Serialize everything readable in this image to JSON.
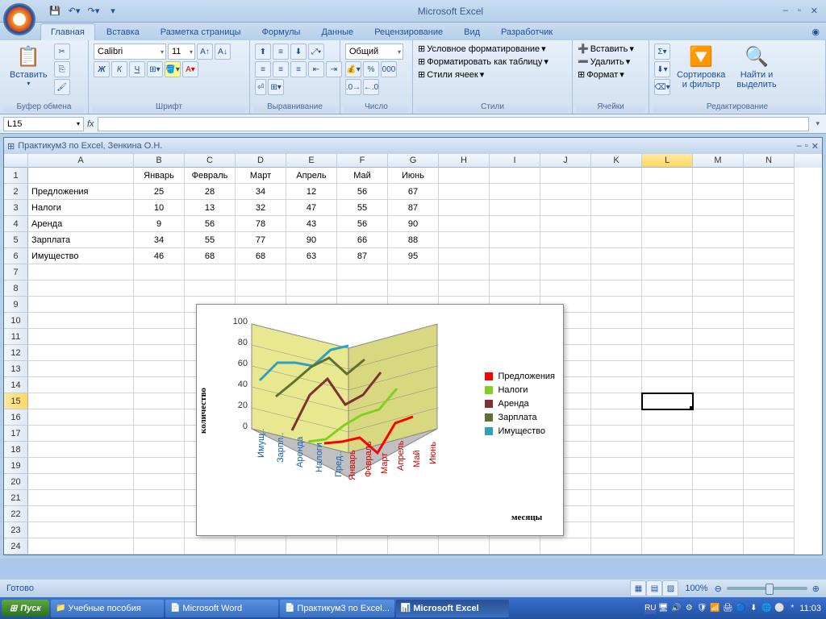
{
  "app": {
    "title": "Microsoft Excel"
  },
  "tabs": [
    "Главная",
    "Вставка",
    "Разметка страницы",
    "Формулы",
    "Данные",
    "Рецензирование",
    "Вид",
    "Разработчик"
  ],
  "ribbon_groups": {
    "clipboard": {
      "paste": "Вставить",
      "label": "Буфер обмена"
    },
    "font": {
      "name": "Calibri",
      "size": "11",
      "label": "Шрифт"
    },
    "align": {
      "label": "Выравнивание"
    },
    "number": {
      "format": "Общий",
      "label": "Число"
    },
    "styles": {
      "cf": "Условное форматирование",
      "fat": "Форматировать как таблицу",
      "cs": "Стили ячеек",
      "label": "Стили"
    },
    "cells": {
      "ins": "Вставить",
      "del": "Удалить",
      "fmt": "Формат",
      "label": "Ячейки"
    },
    "editing": {
      "sort": "Сортировка\nи фильтр",
      "find": "Найти и\nвыделить",
      "label": "Редактирование"
    }
  },
  "namebox": "L15",
  "doc_title": "Практикум3 по Excel, Зенкина О.Н.",
  "columns": [
    "A",
    "B",
    "C",
    "D",
    "E",
    "F",
    "G",
    "H",
    "I",
    "J",
    "K",
    "L",
    "M",
    "N"
  ],
  "table": {
    "headers": [
      "",
      "Январь",
      "Февраль",
      "Март",
      "Апрель",
      "Май",
      "Июнь"
    ],
    "rows": [
      [
        "Предложения",
        "25",
        "28",
        "34",
        "12",
        "56",
        "67"
      ],
      [
        "Налоги",
        "10",
        "13",
        "32",
        "47",
        "55",
        "87"
      ],
      [
        "Аренда",
        "9",
        "56",
        "78",
        "43",
        "56",
        "90"
      ],
      [
        "Зарплата",
        "34",
        "55",
        "77",
        "90",
        "66",
        "88"
      ],
      [
        "Имущество",
        "46",
        "68",
        "68",
        "63",
        "87",
        "95"
      ]
    ]
  },
  "chart_data": {
    "type": "line",
    "title": "",
    "xlabel": "месяцы",
    "ylabel": "количество",
    "categories": [
      "Январь",
      "Февраль",
      "Март",
      "Апрель",
      "Май",
      "Июнь"
    ],
    "depth_axis": [
      "Имущ..",
      "Зарпл..",
      "Аренда",
      "Налоги",
      "Пред.."
    ],
    "ylim": [
      0,
      100
    ],
    "yticks": [
      0,
      20,
      40,
      60,
      80,
      100
    ],
    "series": [
      {
        "name": "Предложения",
        "color": "#ff0000",
        "values": [
          25,
          28,
          34,
          12,
          56,
          67
        ]
      },
      {
        "name": "Налоги",
        "color": "#80d020",
        "values": [
          10,
          13,
          32,
          47,
          55,
          87
        ]
      },
      {
        "name": "Аренда",
        "color": "#803030",
        "values": [
          9,
          56,
          78,
          43,
          56,
          90
        ]
      },
      {
        "name": "Зарплата",
        "color": "#607030",
        "values": [
          34,
          55,
          77,
          90,
          66,
          88
        ]
      },
      {
        "name": "Имущество",
        "color": "#30a0c0",
        "values": [
          46,
          68,
          68,
          63,
          87,
          95
        ]
      }
    ]
  },
  "status": {
    "ready": "Готово",
    "zoom": "100%"
  },
  "taskbar": {
    "start": "Пуск",
    "items": [
      "Учебные пособия",
      "Microsoft Word",
      "Практикум3 по Excel...",
      "Microsoft Excel"
    ],
    "lang": "RU",
    "time": "11:03"
  }
}
